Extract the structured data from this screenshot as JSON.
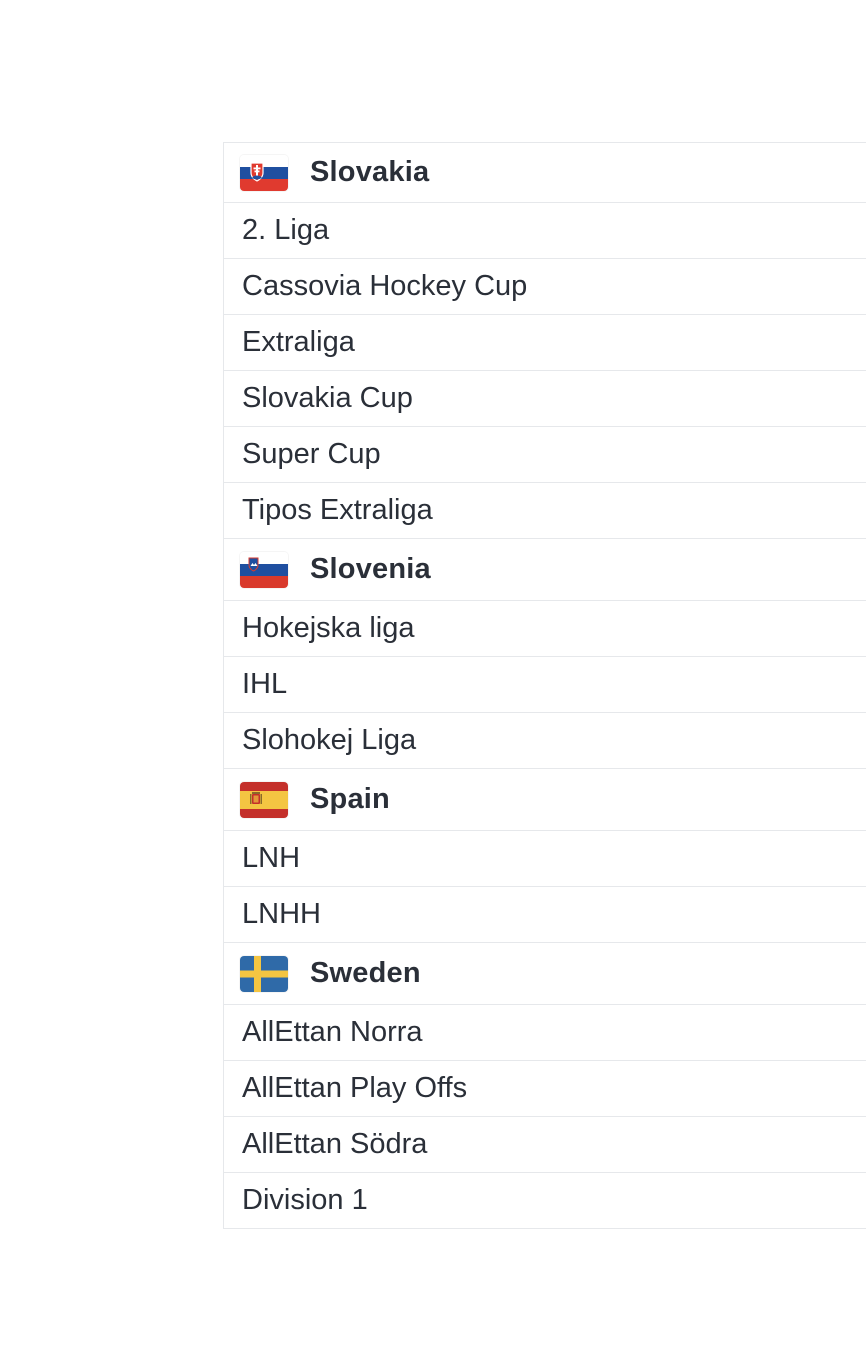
{
  "countries": [
    {
      "name": "Slovakia",
      "flag_icon": "slovakia-flag-icon",
      "leagues": [
        "2. Liga",
        "Cassovia Hockey Cup",
        "Extraliga",
        "Slovakia Cup",
        "Super Cup",
        "Tipos Extraliga"
      ]
    },
    {
      "name": "Slovenia",
      "flag_icon": "slovenia-flag-icon",
      "leagues": [
        "Hokejska liga",
        "IHL",
        "Slohokej Liga"
      ]
    },
    {
      "name": "Spain",
      "flag_icon": "spain-flag-icon",
      "leagues": [
        "LNH",
        "LNHH"
      ]
    },
    {
      "name": "Sweden",
      "flag_icon": "sweden-flag-icon",
      "leagues": [
        "AllEttan Norra",
        "AllEttan Play Offs",
        "AllEttan Södra",
        "Division 1"
      ]
    }
  ],
  "colors": {
    "text": "#2a2f38",
    "border": "#e6e8eb"
  }
}
